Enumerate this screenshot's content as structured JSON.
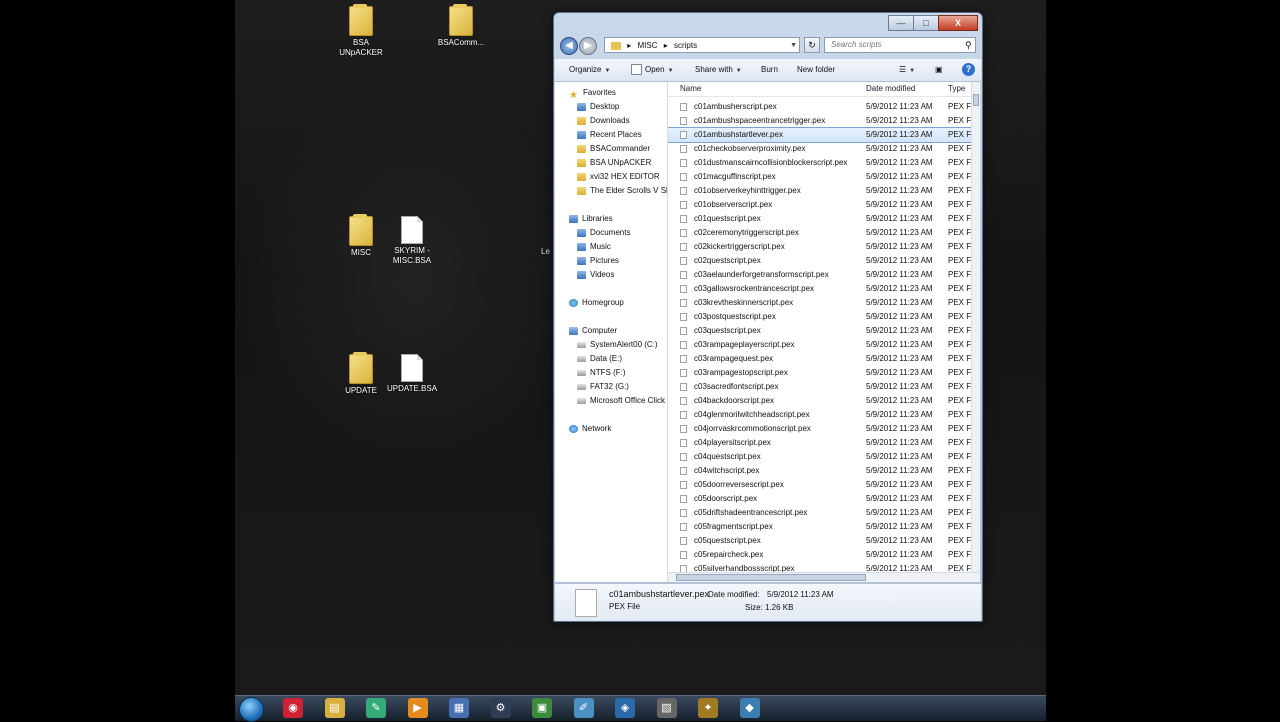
{
  "desktop": {
    "icons": [
      {
        "label": "BSA UNpACKER",
        "kind": "folder"
      },
      {
        "label": "BSAComm...",
        "kind": "folder"
      },
      {
        "label": "MISC",
        "kind": "folder"
      },
      {
        "label": "SKYRIM - MISC.BSA",
        "kind": "file"
      },
      {
        "label": "UPDATE",
        "kind": "folder"
      },
      {
        "label": "UPDATE.BSA",
        "kind": "file"
      }
    ],
    "partial_label": "Le"
  },
  "window": {
    "buttons": {
      "minimize": "—",
      "maximize": "□",
      "close": "X"
    },
    "address": {
      "crumbs": [
        "MISC",
        "scripts"
      ],
      "separator": "▸"
    },
    "search": {
      "placeholder": "Search scripts"
    },
    "toolbar": {
      "organize": "Organize",
      "open": "Open",
      "share_with": "Share with",
      "burn": "Burn",
      "new_folder": "New folder",
      "help": "?"
    },
    "nav": {
      "favorites_header": "Favorites",
      "favorites": [
        "Desktop",
        "Downloads",
        "Recent Places",
        "BSACommander",
        "BSA UNpACKER",
        "xvi32 HEX EDITOR",
        "The Elder Scrolls V Sky"
      ],
      "libraries_header": "Libraries",
      "libraries": [
        "Documents",
        "Music",
        "Pictures",
        "Videos"
      ],
      "homegroup": "Homegroup",
      "computer_header": "Computer",
      "drives": [
        "SystemAlert00 (C:)",
        "Data (E:)",
        "NTFS (F:)",
        "FAT32 (G:)",
        "Microsoft Office Click"
      ],
      "network": "Network"
    },
    "columns": {
      "name": "Name",
      "date": "Date modified",
      "type": "Type"
    },
    "files": [
      {
        "name": "c01ambusherscript.pex",
        "date": "5/9/2012 11:23 AM",
        "type": "PEX F"
      },
      {
        "name": "c01ambushspaceentrancetrigger.pex",
        "date": "5/9/2012 11:23 AM",
        "type": "PEX F"
      },
      {
        "name": "c01ambushstartlever.pex",
        "date": "5/9/2012 11:23 AM",
        "type": "PEX F"
      },
      {
        "name": "c01checkobserverproximity.pex",
        "date": "5/9/2012 11:23 AM",
        "type": "PEX F"
      },
      {
        "name": "c01dustmanscairncollisionblockerscript.pex",
        "date": "5/9/2012 11:23 AM",
        "type": "PEX F"
      },
      {
        "name": "c01macguffinscript.pex",
        "date": "5/9/2012 11:23 AM",
        "type": "PEX F"
      },
      {
        "name": "c01observerkeyhinttrigger.pex",
        "date": "5/9/2012 11:23 AM",
        "type": "PEX F"
      },
      {
        "name": "c01observerscript.pex",
        "date": "5/9/2012 11:23 AM",
        "type": "PEX F"
      },
      {
        "name": "c01questscript.pex",
        "date": "5/9/2012 11:23 AM",
        "type": "PEX F"
      },
      {
        "name": "c02ceremonytriggerscript.pex",
        "date": "5/9/2012 11:23 AM",
        "type": "PEX F"
      },
      {
        "name": "c02kickertriggerscript.pex",
        "date": "5/9/2012 11:23 AM",
        "type": "PEX F"
      },
      {
        "name": "c02questscript.pex",
        "date": "5/9/2012 11:23 AM",
        "type": "PEX F"
      },
      {
        "name": "c03aelaunderforgetransformscript.pex",
        "date": "5/9/2012 11:23 AM",
        "type": "PEX F"
      },
      {
        "name": "c03gallowsrockentrancescript.pex",
        "date": "5/9/2012 11:23 AM",
        "type": "PEX F"
      },
      {
        "name": "c03krevtheskinnerscript.pex",
        "date": "5/9/2012 11:23 AM",
        "type": "PEX F"
      },
      {
        "name": "c03postquestscript.pex",
        "date": "5/9/2012 11:23 AM",
        "type": "PEX F"
      },
      {
        "name": "c03questscript.pex",
        "date": "5/9/2012 11:23 AM",
        "type": "PEX F"
      },
      {
        "name": "c03rampageplayerscript.pex",
        "date": "5/9/2012 11:23 AM",
        "type": "PEX F"
      },
      {
        "name": "c03rampagequest.pex",
        "date": "5/9/2012 11:23 AM",
        "type": "PEX F"
      },
      {
        "name": "c03rampagestopscript.pex",
        "date": "5/9/2012 11:23 AM",
        "type": "PEX F"
      },
      {
        "name": "c03sacredfontscript.pex",
        "date": "5/9/2012 11:23 AM",
        "type": "PEX F"
      },
      {
        "name": "c04backdoorscript.pex",
        "date": "5/9/2012 11:23 AM",
        "type": "PEX F"
      },
      {
        "name": "c04glenmorilwitchheadscript.pex",
        "date": "5/9/2012 11:23 AM",
        "type": "PEX F"
      },
      {
        "name": "c04jorrvaskrcommotionscript.pex",
        "date": "5/9/2012 11:23 AM",
        "type": "PEX F"
      },
      {
        "name": "c04playersitscript.pex",
        "date": "5/9/2012 11:23 AM",
        "type": "PEX F"
      },
      {
        "name": "c04questscript.pex",
        "date": "5/9/2012 11:23 AM",
        "type": "PEX F"
      },
      {
        "name": "c04witchscript.pex",
        "date": "5/9/2012 11:23 AM",
        "type": "PEX F"
      },
      {
        "name": "c05doorreversescript.pex",
        "date": "5/9/2012 11:23 AM",
        "type": "PEX F"
      },
      {
        "name": "c05doorscript.pex",
        "date": "5/9/2012 11:23 AM",
        "type": "PEX F"
      },
      {
        "name": "c05driftshadeentrancescript.pex",
        "date": "5/9/2012 11:23 AM",
        "type": "PEX F"
      },
      {
        "name": "c05fragmentscript.pex",
        "date": "5/9/2012 11:23 AM",
        "type": "PEX F"
      },
      {
        "name": "c05questscript.pex",
        "date": "5/9/2012 11:23 AM",
        "type": "PEX F"
      },
      {
        "name": "c05repaircheck.pex",
        "date": "5/9/2012 11:23 AM",
        "type": "PEX F"
      },
      {
        "name": "c05silverhandbossscript.pex",
        "date": "5/9/2012 11:23 AM",
        "type": "PEX F"
      }
    ],
    "selected_index": 2,
    "details": {
      "filename": "c01ambushstartlever.pex",
      "filetype": "PEX File",
      "date_label": "Date modified:",
      "date_value": "5/9/2012 11:23 AM",
      "size_label": "Size:",
      "size_value": "1.26 KB"
    }
  },
  "taskbar": {
    "items": [
      {
        "icon": "chrome-icon",
        "glyph": "◉"
      },
      {
        "icon": "explorer-icon",
        "glyph": "▤"
      },
      {
        "icon": "tool-icon",
        "glyph": "✎"
      },
      {
        "icon": "media-player-icon",
        "glyph": "▶"
      },
      {
        "icon": "meter-icon",
        "glyph": "▦"
      },
      {
        "icon": "steam-icon",
        "glyph": "⚙"
      },
      {
        "icon": "document-icon",
        "glyph": "▣"
      },
      {
        "icon": "paint-icon",
        "glyph": "✐"
      },
      {
        "icon": "photo-icon",
        "glyph": "◈"
      },
      {
        "icon": "clapper-icon",
        "glyph": "▧"
      },
      {
        "icon": "game-icon",
        "glyph": "✦"
      },
      {
        "icon": "utility-icon",
        "glyph": "◆"
      }
    ]
  }
}
